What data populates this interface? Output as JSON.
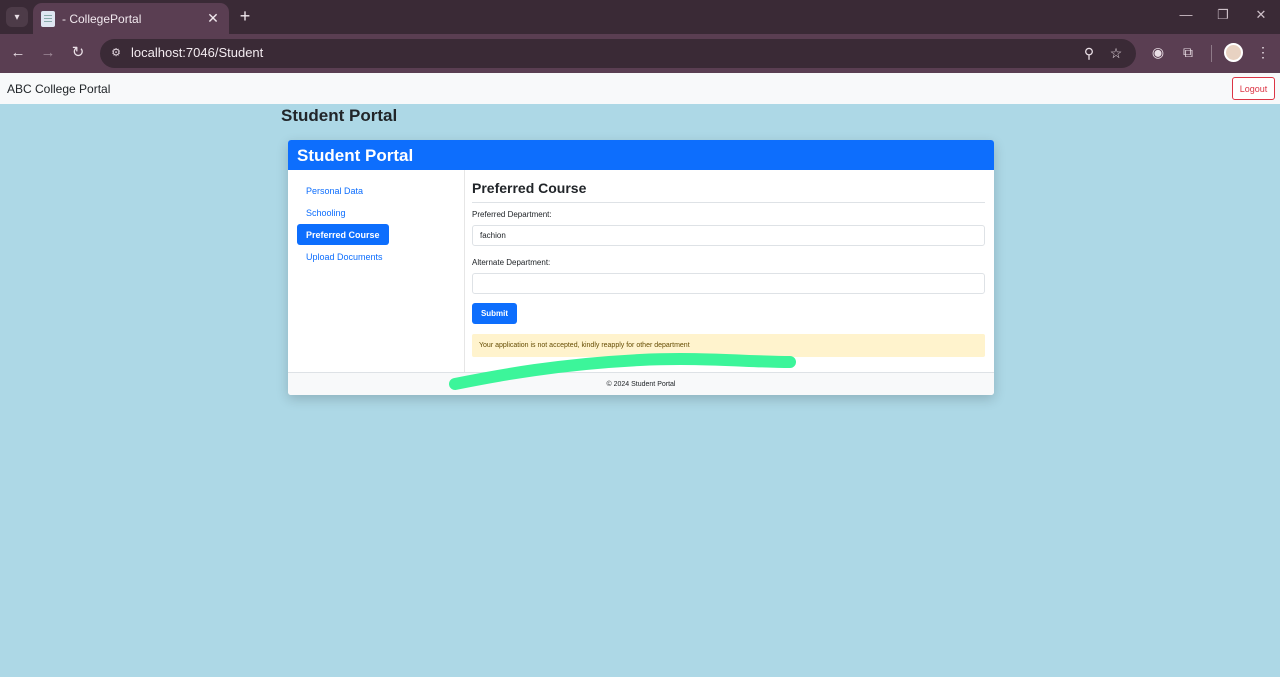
{
  "browser": {
    "tab_title": "- CollegePortal",
    "url": "localhost:7046/Student"
  },
  "app": {
    "brand": "ABC College Portal",
    "logout_label": "Logout"
  },
  "page": {
    "title": "Student Portal"
  },
  "card": {
    "header": "Student Portal",
    "sidebar": [
      {
        "label": "Personal Data",
        "active": false
      },
      {
        "label": "Schooling",
        "active": false
      },
      {
        "label": "Preferred Course",
        "active": true
      },
      {
        "label": "Upload Documents",
        "active": false
      }
    ],
    "section_title": "Preferred Course",
    "preferred_label": "Preferred Department:",
    "preferred_value": "fachion",
    "alternate_label": "Alternate Department:",
    "alternate_value": "",
    "submit_label": "Submit",
    "alert_text": "Your application is not accepted, kindly reapply for other department",
    "footer": "© 2024 Student Portal"
  },
  "colors": {
    "page_bg": "#add8e6",
    "primary": "#0d6efd",
    "danger": "#dc3545",
    "alert_bg": "#fff3cd",
    "scribble": "#3cf59a"
  },
  "icons": [
    "tab-list-icon",
    "page-icon",
    "close-icon",
    "plus-icon",
    "minimize-icon",
    "restore-icon",
    "back-icon",
    "forward-icon",
    "reload-icon",
    "site-info-icon",
    "zoom-icon",
    "star-icon",
    "extension-icon",
    "puzzle-icon",
    "avatar",
    "more-icon"
  ]
}
